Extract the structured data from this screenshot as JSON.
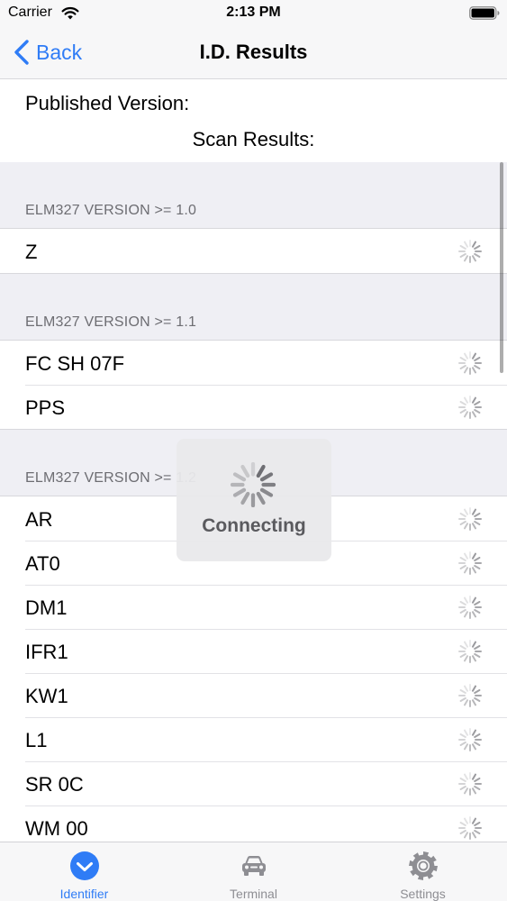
{
  "status_bar": {
    "carrier": "Carrier",
    "time": "2:13 PM",
    "wifi_icon": "wifi-icon",
    "battery_icon": "battery-icon"
  },
  "nav": {
    "back_label": "Back",
    "title": "I.D. Results",
    "back_icon": "chevron-left-icon"
  },
  "info": {
    "published_version": "Published Version:",
    "scan_results": "Scan Results:"
  },
  "sections": [
    {
      "header": "ELM327 VERSION >= 1.0",
      "items": [
        "Z"
      ]
    },
    {
      "header": "ELM327 VERSION >= 1.1",
      "items": [
        "FC SH 07F",
        "PPS"
      ]
    },
    {
      "header": "ELM327 VERSION >= 1.2",
      "items": [
        "AR",
        "AT0",
        "DM1",
        "IFR1",
        "KW1",
        "L1",
        "SR 0C",
        "WM 00"
      ]
    }
  ],
  "hud": {
    "label": "Connecting",
    "icon": "spinner-icon"
  },
  "tabs": [
    {
      "label": "Identifier",
      "icon": "checkmark-circle-icon",
      "active": true
    },
    {
      "label": "Terminal",
      "icon": "car-icon",
      "active": false
    },
    {
      "label": "Settings",
      "icon": "gear-icon",
      "active": false
    }
  ],
  "colors": {
    "accent": "#2f7cf6",
    "inactive": "#8e8e93",
    "header_text": "#6d6d72",
    "grouped_background": "#efeff4"
  }
}
